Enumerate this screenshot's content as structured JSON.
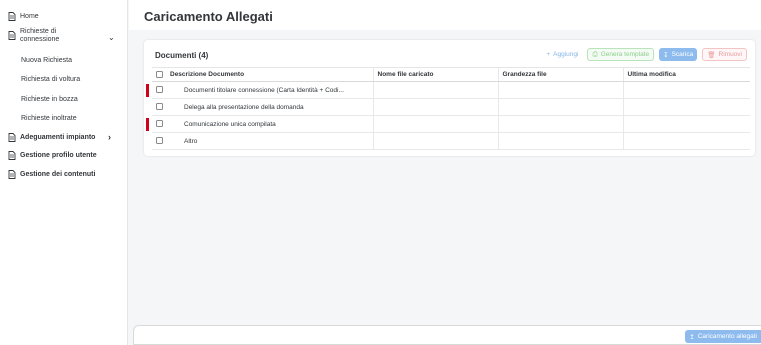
{
  "sidebar": {
    "items": [
      {
        "label": "Home",
        "icon": "page-icon"
      },
      {
        "label": "Richieste di connessione",
        "line1": "Richieste di",
        "line2": "connessione",
        "icon": "page-icon",
        "expanded": true,
        "children": [
          "Nuova Richiesta",
          "Richiesta di voltura",
          "Richieste in bozza",
          "Richieste inoltrate"
        ]
      },
      {
        "label": "Adeguamenti impianto",
        "icon": "page-icon"
      },
      {
        "label": "Gestione profilo utente",
        "icon": "page-icon"
      },
      {
        "label": "Gestione dei contenuti",
        "icon": "page-icon"
      }
    ]
  },
  "page": {
    "title": "Caricamento Allegati"
  },
  "card": {
    "title": "Documenti (4)",
    "toolbar": {
      "add": "Aggiungi",
      "generate": "Genera template",
      "download": "Scarica",
      "remove": "Rimuovi"
    },
    "columns": [
      "Descrizione Documento",
      "Nome file caricato",
      "Grandezza file",
      "Ultima modifica"
    ],
    "rows": [
      {
        "description": "Documenti titolare connessione (Carta Identità + Codi...",
        "file": "",
        "size": "",
        "modified": "",
        "required": true
      },
      {
        "description": "Delega alla presentazione della domanda",
        "file": "",
        "size": "",
        "modified": "",
        "required": false
      },
      {
        "description": "Comunicazione unica compilata",
        "file": "",
        "size": "",
        "modified": "",
        "required": true
      },
      {
        "description": "Altro",
        "file": "",
        "size": "",
        "modified": "",
        "required": false
      }
    ]
  },
  "footer": {
    "upload_button": "Caricamento allegati"
  },
  "colors": {
    "accent": "#8dbbee",
    "required_marker": "#d0021b",
    "success": "#8ccf8c",
    "danger": "#e69a9a"
  }
}
